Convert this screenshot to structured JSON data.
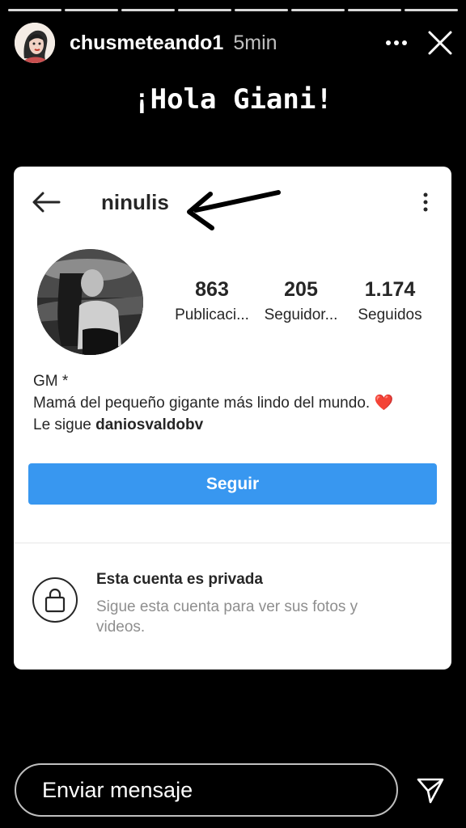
{
  "story": {
    "progress_segments": 8,
    "username": "chusmeteando1",
    "time_ago": "5min",
    "greeting": "¡Hola Giani!"
  },
  "profile": {
    "username": "ninulis",
    "stats": [
      {
        "value": "863",
        "label": "Publicaci..."
      },
      {
        "value": "205",
        "label": "Seguidor..."
      },
      {
        "value": "1.174",
        "label": "Seguidos"
      }
    ],
    "bio_name": "GM *",
    "bio_text": "Mamá del pequeño gigante más lindo del mundo.",
    "bio_emoji": "❤️",
    "followed_by_prefix": "Le sigue ",
    "followed_by_user": "daniosvaldobv",
    "follow_button": "Seguir",
    "private_title": "Esta cuenta es privada",
    "private_subtitle": "Sigue esta cuenta para ver sus fotos y videos."
  },
  "footer": {
    "message_placeholder": "Enviar mensaje"
  },
  "colors": {
    "follow_button": "#3897f0",
    "story_background": "#000000",
    "heart": "#e0413c"
  }
}
